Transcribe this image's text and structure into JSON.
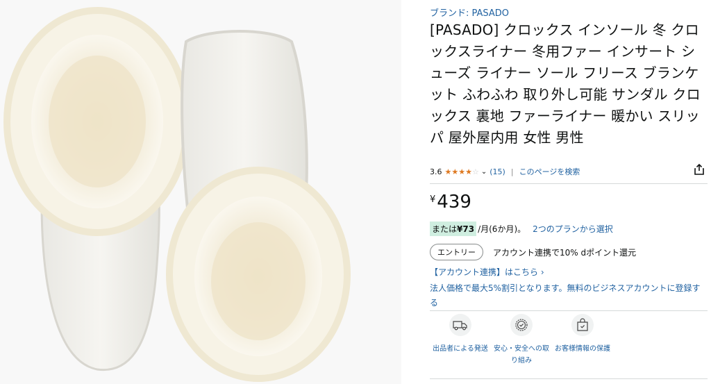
{
  "product": {
    "brand_line": "ブランド: PASADO",
    "title": "[PASADO] クロックス インソール 冬 クロックスライナー 冬用ファー インサート シューズ ライナー ソール フリース ブランケット ふわふわ 取り外し可能 サンダル クロックス 裏地 ファーライナー 暖かい スリッパ 屋外屋内用 女性 男性",
    "image_alt": "product-photo"
  },
  "rating": {
    "value": "3.6",
    "stars": [
      1,
      1,
      1,
      0.5,
      0
    ],
    "review_count": "(15)",
    "separator": "|",
    "search_link": "このページを検索"
  },
  "price": {
    "currency": "¥",
    "amount": "439"
  },
  "installment": {
    "prefix": "または",
    "amount": "¥73",
    "suffix": "/月(6か月)。",
    "plans_link": "2つのプランから選択"
  },
  "points": {
    "entry_button": "エントリー",
    "text": "アカウント連携で10% dポイント還元"
  },
  "account_link": "【アカウント連携】はこちら ›",
  "business": "法人価格で最大5%割引となります。無料のビジネスアカウントに登録する",
  "features": [
    {
      "icon": "truck-icon",
      "label": "出品者による発送"
    },
    {
      "icon": "shield-check-icon",
      "label": "安心・安全への取り組み"
    },
    {
      "icon": "secure-bag-icon",
      "label": "お客様情報の保護"
    }
  ],
  "colors": {
    "link": "#2162a1",
    "star": "#de7921",
    "installment_bg": "#cfeee0"
  }
}
